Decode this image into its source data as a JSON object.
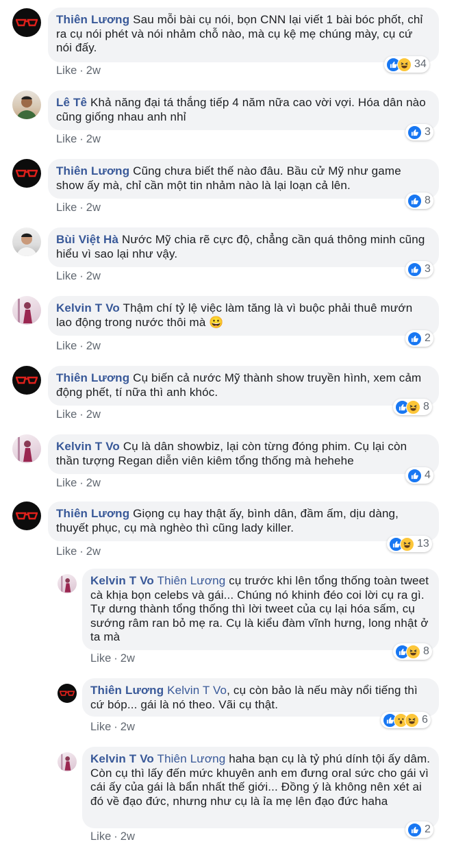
{
  "comments": [
    {
      "name": "Thiên Lương",
      "text": "Sau mỗi bài cụ nói, bọn CNN lại viết 1 bài bóc phốt, chỉ ra cụ nói phét và nói nhảm chỗ nào, mà cụ kệ mẹ chúng mày, cụ cứ nói đấy.",
      "like": "Like",
      "time": "2w",
      "reaction_count": "34",
      "reactions": [
        "like-icon",
        "haha-icon"
      ]
    },
    {
      "name": "Lê Tê",
      "text": "Khả năng đại tá thắng tiếp 4 năm nữa cao vời vợi. Hóa dân nào cũng giống nhau anh nhỉ",
      "like": "Like",
      "time": "2w",
      "reaction_count": "3",
      "reactions": [
        "like-icon"
      ]
    },
    {
      "name": "Thiên Lương",
      "text": "Cũng chưa biết thế nào đâu. Bầu cử Mỹ như game show ấy mà, chỉ cần một tin nhảm nào là lại loạn cả lên.",
      "like": "Like",
      "time": "2w",
      "reaction_count": "8",
      "reactions": [
        "like-icon"
      ]
    },
    {
      "name": "Bùi Việt Hà",
      "text": "Nước Mỹ chia rẽ cực độ, chẳng cần quá thông minh cũng hiểu vì sao lại như vậy.",
      "like": "Like",
      "time": "2w",
      "reaction_count": "3",
      "reactions": [
        "like-icon"
      ]
    },
    {
      "name": "Kelvin T Vo",
      "text": "Thậm chí tỷ lệ việc làm tăng là vì buộc phải thuê mướn lao động trong nước thôi mà",
      "emoji": "😀",
      "like": "Like",
      "time": "2w",
      "reaction_count": "2",
      "reactions": [
        "like-icon"
      ]
    },
    {
      "name": "Thiên Lương",
      "text": "Cụ biến cả nước Mỹ thành show truyền hình, xem cảm động phết, tí nữa thì anh khóc.",
      "like": "Like",
      "time": "2w",
      "reaction_count": "8",
      "reactions": [
        "like-icon",
        "haha-icon"
      ]
    },
    {
      "name": "Kelvin T Vo",
      "text": "Cụ là dân showbiz, lại còn từng đóng phim. Cụ lại còn thần tượng Regan diễn viên kiêm tổng thống mà hehehe",
      "like": "Like",
      "time": "2w",
      "reaction_count": "4",
      "reactions": [
        "like-icon"
      ]
    },
    {
      "name": "Thiên Lương",
      "text": "Giọng cụ hay thật ấy, bình dân, đầm ấm, dịu dàng, thuyết phục, cụ mà nghèo thì cũng lady killer.",
      "like": "Like",
      "time": "2w",
      "reaction_count": "13",
      "reactions": [
        "like-icon",
        "haha-icon"
      ]
    }
  ],
  "replies": [
    {
      "name": "Kelvin T Vo",
      "mention": "Thiên Lương",
      "text": "cụ trước khi lên tổng thống toàn tweet cà khịa bọn celebs và gái... Chúng nó khinh đéo coi lời cụ ra gì. Tự dưng thành tổng thống thì lời tweet của cụ lại hóa sấm, cụ sướng râm ran bỏ mẹ ra. Cụ là kiểu đàm vĩnh hưng, long nhật ở ta mà",
      "like": "Like",
      "time": "2w",
      "reaction_count": "8",
      "reactions": [
        "like-icon",
        "haha-icon"
      ]
    },
    {
      "name": "Thiên Lương",
      "mention": "Kelvin T Vo",
      "text": ", cụ còn bảo là nếu mày nổi tiếng thì cứ bóp... gái là nó theo. Vãi cụ thật.",
      "like": "Like",
      "time": "2w",
      "reaction_count": "6",
      "reactions": [
        "like-icon",
        "wow-icon",
        "haha-icon"
      ]
    },
    {
      "name": "Kelvin T Vo",
      "mention": "Thiên Lương",
      "text": "haha bạn cụ là tỷ phú dính tội ấy dâm. Còn cụ thì lấy đến mức khuyên anh em đưng oral sức cho gái vì cái ấy của gái là bẩn nhất thế giới... Đồng ý là không nên xét ai đó về đạo đức, nhưng như cụ là ỉa mẹ lên đạo đức haha",
      "like": "Like",
      "time": "2w",
      "reaction_count": "2",
      "reactions": [
        "like-icon"
      ]
    }
  ],
  "colors": {
    "link": "#385898",
    "bubble": "#f2f3f5",
    "like_blue": "#1877f2",
    "haha_yellow": "#fcc639",
    "meta": "#606770"
  }
}
